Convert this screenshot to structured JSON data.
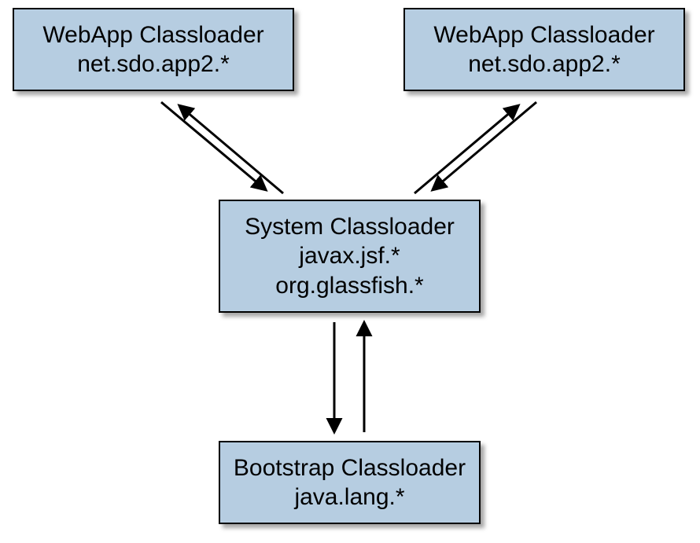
{
  "chart_data": {
    "type": "diagram",
    "nodes": [
      {
        "id": "webapp_left",
        "title": "WebApp Classloader",
        "subtitle": "net.sdo.app2.*"
      },
      {
        "id": "webapp_right",
        "title": "WebApp Classloader",
        "subtitle": "net.sdo.app2.*"
      },
      {
        "id": "system",
        "title": "System Classloader",
        "line2": "javax.jsf.*",
        "line3": "org.glassfish.*"
      },
      {
        "id": "bootstrap",
        "title": "Bootstrap Classloader",
        "subtitle": "java.lang.*"
      }
    ],
    "edges": [
      {
        "from": "webapp_left",
        "to": "system",
        "bidirectional": true
      },
      {
        "from": "webapp_right",
        "to": "system",
        "bidirectional": true
      },
      {
        "from": "system",
        "to": "bootstrap",
        "bidirectional": true
      }
    ]
  },
  "boxes": {
    "webapp_left": {
      "title": "WebApp Classloader",
      "subtitle": "net.sdo.app2.*"
    },
    "webapp_right": {
      "title": "WebApp Classloader",
      "subtitle": "net.sdo.app2.*"
    },
    "system": {
      "title": "System Classloader",
      "line2": "javax.jsf.*",
      "line3": "org.glassfish.*"
    },
    "bootstrap": {
      "title": "Bootstrap Classloader",
      "subtitle": "java.lang.*"
    }
  },
  "colors": {
    "box_fill": "#b6cde1",
    "box_border": "#000000",
    "arrow": "#000000"
  }
}
